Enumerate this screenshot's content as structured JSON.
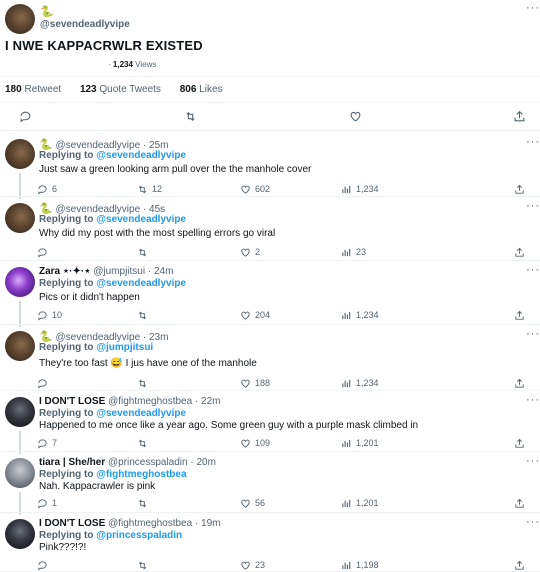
{
  "main": {
    "emoji": "🐍",
    "handle": "@sevendeadlyvipe",
    "text": "I NWE KAPPACRWLR EXISTED",
    "views_sep": "·",
    "views_count": "1,234",
    "views_label": "Views",
    "retweets_count": "180",
    "retweets_label": "Retweet",
    "quotes_count": "123",
    "quotes_label": "Quote Tweets",
    "likes_count": "806",
    "likes_label": "Likes",
    "more": "···"
  },
  "replies": [
    {
      "emoji": "🐍",
      "name": "",
      "handle": "@sevendeadlyvipe",
      "time": "· 25m",
      "replying_label": "Replying to",
      "replying_to": "@sevendeadlyvipe",
      "text": "Just saw a green looking arm pull over the the manhole cover",
      "replies": "6",
      "retweets": "12",
      "likes": "602",
      "views": "1,234",
      "avatar": "brown"
    },
    {
      "emoji": "🐍",
      "name": "",
      "handle": "@sevendeadlyvipe",
      "time": "· 45s",
      "replying_label": "Replying to",
      "replying_to": "@sevendeadlyvipe",
      "text": "Why did my post with the most spelling errors go viral",
      "replies": "",
      "retweets": "",
      "likes": "2",
      "views": "23",
      "avatar": "brown"
    },
    {
      "emoji": "",
      "name": "Zara ⋆·✦·⋆",
      "handle": "@jumpjitsui",
      "time": "· 24m",
      "replying_label": "Replying to",
      "replying_to": "@sevendeadlyvipe",
      "text": "Pics or it didn't happen",
      "replies": "10",
      "retweets": "",
      "likes": "204",
      "views": "1,234",
      "avatar": "purple"
    },
    {
      "emoji": "🐍",
      "name": "",
      "handle": "@sevendeadlyvipe",
      "time": "· 23m",
      "replying_label": "Replying to",
      "replying_to": "@jumpjitsui",
      "text": "They're too fast 😅 I jus have one of the manhole",
      "replies": "",
      "retweets": "",
      "likes": "188",
      "views": "1,234",
      "avatar": "brown"
    },
    {
      "emoji": "",
      "name": "I DON'T LOSE",
      "handle": "@fightmeghostbea",
      "time": "· 22m",
      "replying_label": "Replying to",
      "replying_to": "@sevendeadlyvipe",
      "text": "Happened to me once like a year ago. Some green guy with a purple mask climbed in",
      "replies": "7",
      "retweets": "",
      "likes": "109",
      "views": "1,201",
      "avatar": "dark"
    },
    {
      "emoji": "",
      "name": "tiara | She/her",
      "handle": "@princesspaladin",
      "time": "· 20m",
      "replying_label": "Replying to",
      "replying_to": "@fightmeghostbea",
      "text": "Nah. Kappacrawler is pink",
      "replies": "1",
      "retweets": "",
      "likes": "56",
      "views": "1,201",
      "avatar": "gray"
    },
    {
      "emoji": "",
      "name": "I DON'T LOSE",
      "handle": "@fightmeghostbea",
      "time": "· 19m",
      "replying_label": "Replying to",
      "replying_to": "@princesspaladin",
      "text": "Pink???!?!",
      "replies": "",
      "retweets": "",
      "likes": "23",
      "views": "1,198",
      "avatar": "dark"
    }
  ]
}
